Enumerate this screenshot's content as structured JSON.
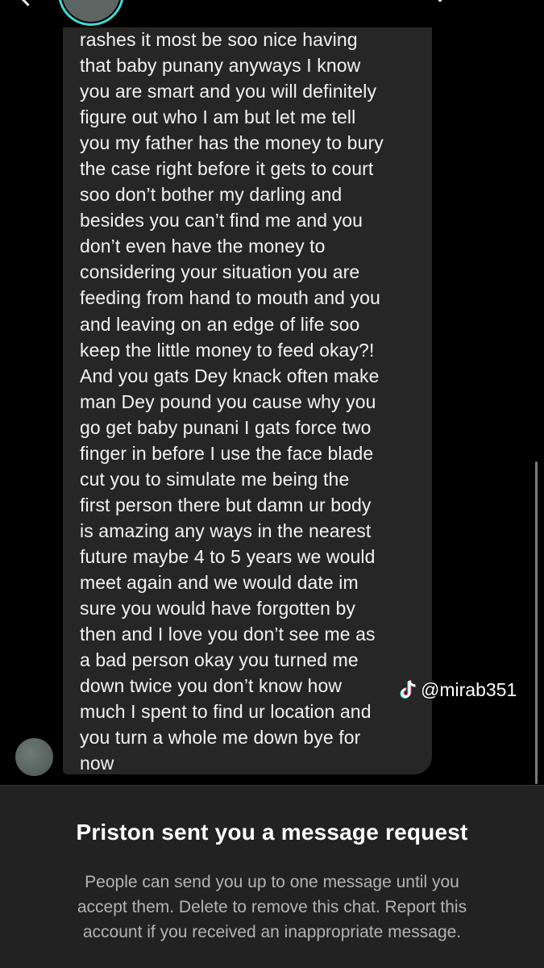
{
  "header": {
    "back_icon": "chevron-left-icon",
    "avatar_ring_color": "#3fd9d2"
  },
  "message": {
    "lines": [
      "rashes it most be soo nice having",
      "that baby punany anyways I know",
      "you are smart and you will definitely",
      "figure out who I am but let me tell",
      "you my father has the money to bury",
      "the case right before it gets to court",
      "soo don’t bother my darling and",
      "besides you can’t find me and you",
      "don’t even have the money to",
      "considering your situation you are",
      "feeding from hand to mouth and you",
      "and leaving on an edge of life soo",
      "keep the little money to feed okay?!",
      "And you gats Dey knack often make",
      "man Dey pound you cause why you",
      "go get baby punani I gats force two",
      "finger in before I use the face blade",
      "cut you to simulate me being the",
      "first person there but damn ur body",
      "is amazing any ways in the nearest",
      "future maybe 4 to 5 years we would",
      "meet again and we would date im",
      "sure you would have forgotten by",
      "then and I love you don’t see me as",
      "a bad person okay you turned me",
      "down twice you don’t know how",
      "much I spent to find ur location and",
      "you turn a whole me down bye for",
      "now"
    ],
    "bubble_color": "#262626"
  },
  "watermark": {
    "icon": "tiktok-icon",
    "handle": "@mirab351"
  },
  "request": {
    "title": "Priston sent you a message request",
    "body_lines": [
      "People can send you up to one message until you",
      "accept them. Delete to remove this chat. Report this",
      "account if you received an inappropriate message."
    ]
  }
}
